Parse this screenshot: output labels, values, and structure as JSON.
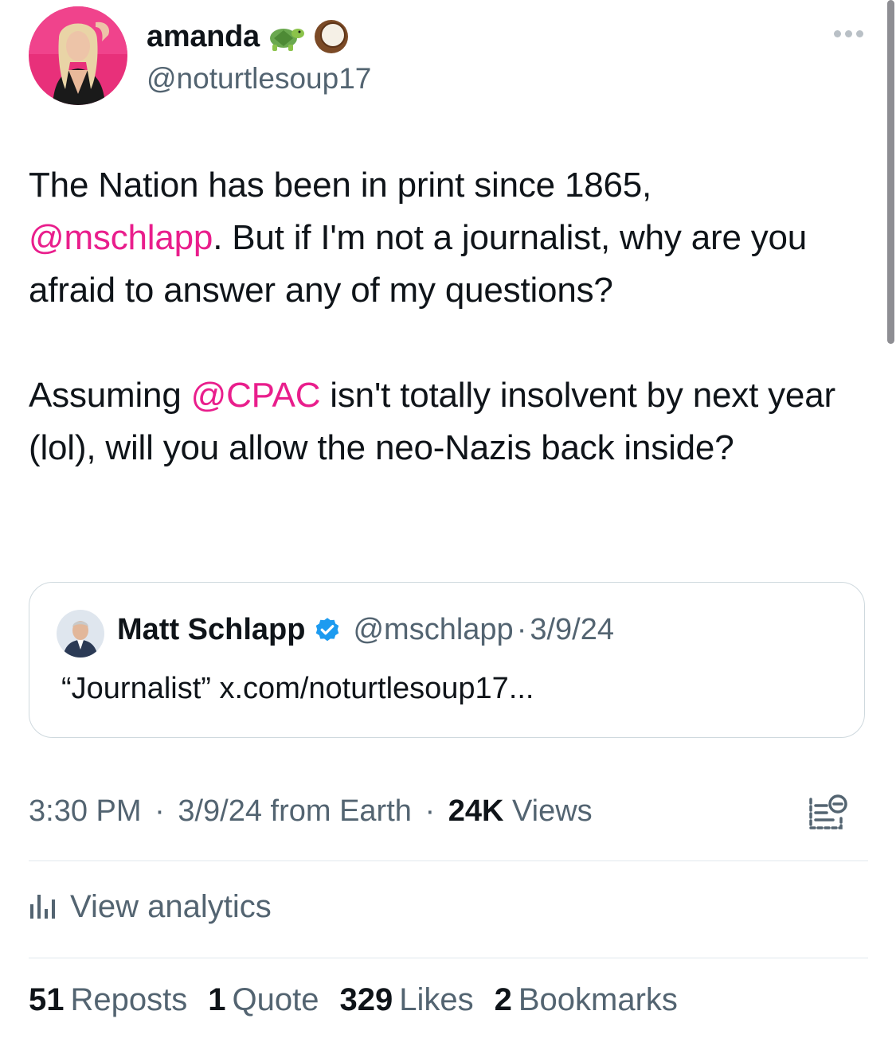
{
  "author": {
    "display_name": "amanda",
    "name_emojis": [
      "turtle-emoji",
      "coconut-emoji"
    ],
    "handle": "@noturtlesoup17"
  },
  "tweet": {
    "para1": {
      "text_before": "The Nation has been in print since 1865, ",
      "mention": "@mschlapp",
      "text_after": ". But if I'm not a journalist, why are you afraid to answer any of my questions?"
    },
    "para2": {
      "text_before": "Assuming ",
      "mention": "@CPAC",
      "text_after": " isn't totally insolvent by next year (lol), will you allow the neo-Nazis back inside?"
    }
  },
  "quote": {
    "name": "Matt Schlapp",
    "handle": "@mschlapp",
    "separator": "·",
    "date": "3/9/24",
    "text": "“Journalist” x.com/noturtlesoup17..."
  },
  "meta": {
    "time": "3:30 PM",
    "separator": "·",
    "date_source": "3/9/24 from Earth",
    "views_count": "24K",
    "views_label": "Views"
  },
  "analytics_label": "View analytics",
  "stats": [
    {
      "count": "51",
      "label": "Reposts"
    },
    {
      "count": "1",
      "label": "Quote"
    },
    {
      "count": "329",
      "label": "Likes"
    },
    {
      "count": "2",
      "label": "Bookmarks"
    }
  ],
  "colors": {
    "mention": "#e91e8c",
    "verified": "#1d9bf0",
    "secondary_text": "#536471",
    "primary_text": "#0f1419"
  }
}
